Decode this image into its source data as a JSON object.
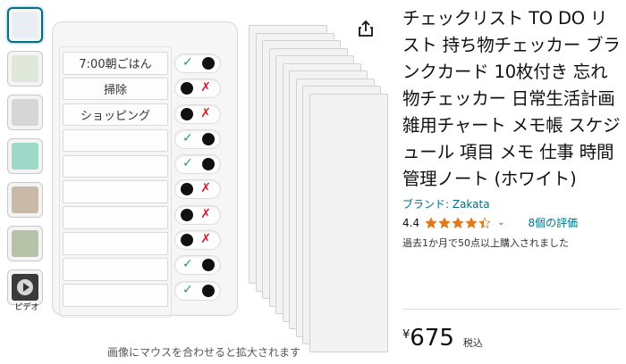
{
  "thumbnails": [
    {
      "name": "thumb-1",
      "color": "#e8eef3",
      "selected": true
    },
    {
      "name": "thumb-2",
      "color": "#dfe8d9"
    },
    {
      "name": "thumb-3",
      "color": "#d6d6d6"
    },
    {
      "name": "thumb-4",
      "color": "#9ed8c8"
    },
    {
      "name": "thumb-5",
      "color": "#c8b9a8"
    },
    {
      "name": "thumb-6",
      "color": "#b8c2a8"
    },
    {
      "name": "thumb-7",
      "color": "#3a3a3a"
    }
  ],
  "video_label": "ビデオ",
  "checklist": {
    "rows": [
      "7:00朝ごはん",
      "掃除",
      "ショッピング",
      "",
      "",
      "",
      "",
      "",
      "",
      ""
    ],
    "toggles": [
      "check",
      "cross",
      "cross",
      "check",
      "check",
      "cross",
      "cross",
      "cross",
      "check",
      "check"
    ],
    "check_symbol": "✓",
    "cross_symbol": "✗"
  },
  "zoom_hint": "画像にマウスを合わせると拡大されます",
  "product": {
    "title": "チェックリスト TO DO リスト 持ち物チェッカー ブランクカード 10枚付き 忘れ物チェッカー 日常生活計画 雑用チャート メモ帳 スケジュール 項目 メモ 仕事 時間管理ノート (ホワイト)",
    "brand": "ブランド: Zakata",
    "rating": "4.4",
    "rating_value": 4.4,
    "chevron": "⌄",
    "reviews": "8個の評価",
    "bought": "過去1か月で50点以上購入されました",
    "currency": "¥",
    "price": "675",
    "tax": "税込"
  },
  "colors": {
    "accent": "#007185",
    "star": "#de7921",
    "check": "#1f9a74",
    "cross": "#d0202a"
  }
}
